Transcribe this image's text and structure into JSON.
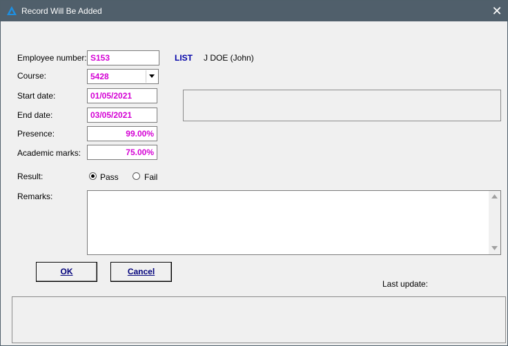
{
  "window": {
    "title": "Record Will Be Added",
    "close_glyph": "✕"
  },
  "labels": {
    "employee_number": "Employee number:",
    "course": "Course:",
    "start_date": "Start date:",
    "end_date": "End date:",
    "presence": "Presence:",
    "academic_marks": "Academic marks:",
    "result": "Result:",
    "remarks": "Remarks:",
    "last_update": "Last update:"
  },
  "fields": {
    "employee_number": "S153",
    "course": "5428",
    "start_date": "01/05/2021",
    "end_date": "03/05/2021",
    "presence": "99.00%",
    "academic_marks": "75.00%",
    "remarks": ""
  },
  "list_link": "LIST",
  "employee_name": "J DOE (John)",
  "result": {
    "options": [
      "Pass",
      "Fail"
    ],
    "selected": "Pass"
  },
  "buttons": {
    "ok": "OK",
    "cancel": "Cancel"
  },
  "colors": {
    "titlebar": "#505f6b",
    "field_text": "#d400d4",
    "link": "#0000a8"
  }
}
